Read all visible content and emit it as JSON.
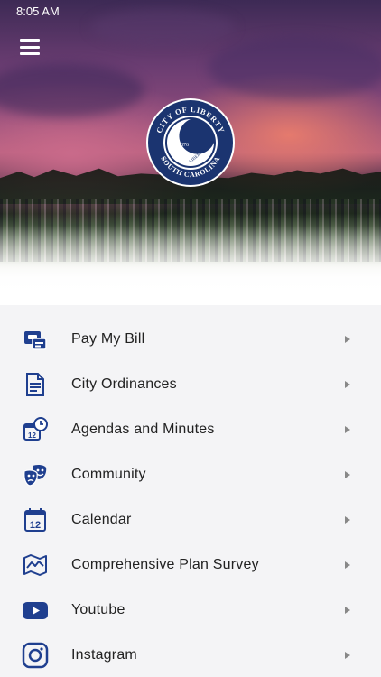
{
  "status_bar": {
    "time": "8:05 AM"
  },
  "header": {
    "menu_icon": "hamburger-menu-icon",
    "seal": {
      "top_text": "CITY OF LIBERTY",
      "bottom_text": "SOUTH CAROLINA",
      "year": "1876",
      "inner_text": "LIBERTY"
    }
  },
  "colors": {
    "icon": "#1f3f8f",
    "chevron": "#888888",
    "seal": "#1b3470"
  },
  "menu": {
    "items": [
      {
        "label": "Pay My Bill",
        "icon": "bill-payment-icon"
      },
      {
        "label": "City Ordinances",
        "icon": "document-icon"
      },
      {
        "label": "Agendas and Minutes",
        "icon": "calendar-clock-icon"
      },
      {
        "label": "Community",
        "icon": "theater-masks-icon"
      },
      {
        "label": "Calendar",
        "icon": "calendar-icon"
      },
      {
        "label": "Comprehensive Plan Survey",
        "icon": "map-icon"
      },
      {
        "label": "Youtube",
        "icon": "youtube-icon"
      },
      {
        "label": "Instagram",
        "icon": "instagram-icon"
      }
    ]
  }
}
